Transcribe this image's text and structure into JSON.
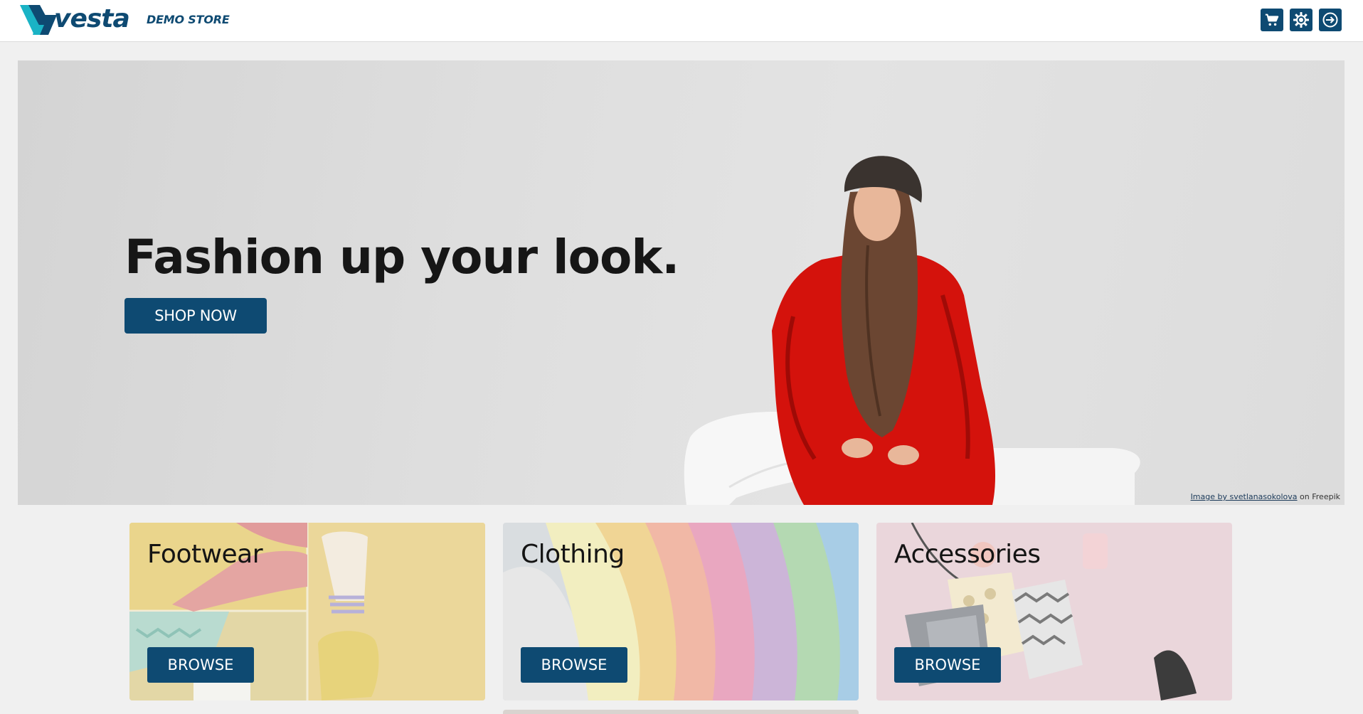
{
  "header": {
    "logo_text": "vesta",
    "store_label": "DEMO STORE",
    "actions": [
      {
        "name": "cart-icon",
        "label": "Cart"
      },
      {
        "name": "gear-icon",
        "label": "Settings"
      },
      {
        "name": "login-icon",
        "label": "Sign in"
      }
    ]
  },
  "hero": {
    "headline": "Fashion up your look.",
    "cta_label": "SHOP NOW",
    "credit_link": "Image by svetlanasokolova",
    "credit_suffix": " on Freepik"
  },
  "categories": [
    {
      "title": "Footwear",
      "button": "BROWSE"
    },
    {
      "title": "Clothing",
      "button": "BROWSE"
    },
    {
      "title": "Accessories",
      "button": "BROWSE"
    }
  ],
  "colors": {
    "brand": "#0e4a72",
    "accent_teal": "#1ab3c5",
    "background": "#f0f0f0"
  }
}
